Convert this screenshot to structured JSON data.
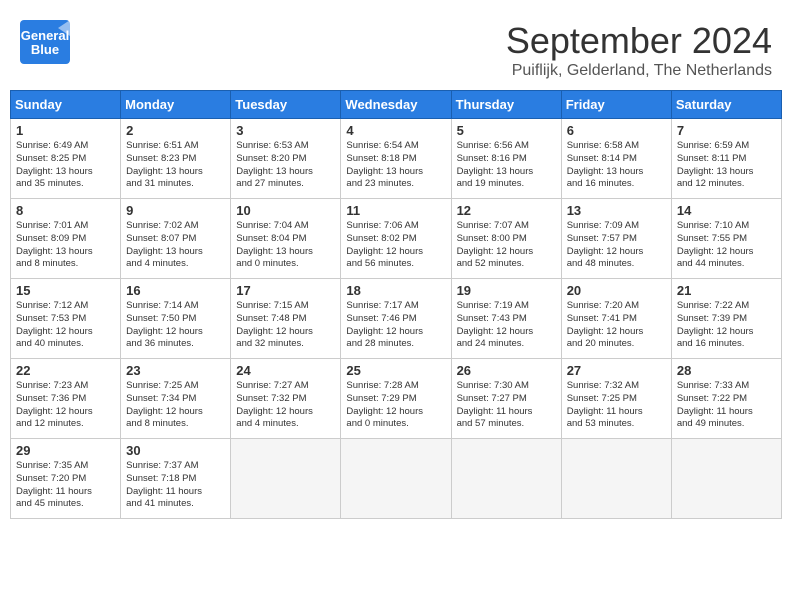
{
  "header": {
    "logo_line1": "General",
    "logo_line2": "Blue",
    "month": "September 2024",
    "location": "Puiflijk, Gelderland, The Netherlands"
  },
  "weekdays": [
    "Sunday",
    "Monday",
    "Tuesday",
    "Wednesday",
    "Thursday",
    "Friday",
    "Saturday"
  ],
  "weeks": [
    [
      {
        "day": "1",
        "info": "Sunrise: 6:49 AM\nSunset: 8:25 PM\nDaylight: 13 hours\nand 35 minutes."
      },
      {
        "day": "2",
        "info": "Sunrise: 6:51 AM\nSunset: 8:23 PM\nDaylight: 13 hours\nand 31 minutes."
      },
      {
        "day": "3",
        "info": "Sunrise: 6:53 AM\nSunset: 8:20 PM\nDaylight: 13 hours\nand 27 minutes."
      },
      {
        "day": "4",
        "info": "Sunrise: 6:54 AM\nSunset: 8:18 PM\nDaylight: 13 hours\nand 23 minutes."
      },
      {
        "day": "5",
        "info": "Sunrise: 6:56 AM\nSunset: 8:16 PM\nDaylight: 13 hours\nand 19 minutes."
      },
      {
        "day": "6",
        "info": "Sunrise: 6:58 AM\nSunset: 8:14 PM\nDaylight: 13 hours\nand 16 minutes."
      },
      {
        "day": "7",
        "info": "Sunrise: 6:59 AM\nSunset: 8:11 PM\nDaylight: 13 hours\nand 12 minutes."
      }
    ],
    [
      {
        "day": "8",
        "info": "Sunrise: 7:01 AM\nSunset: 8:09 PM\nDaylight: 13 hours\nand 8 minutes."
      },
      {
        "day": "9",
        "info": "Sunrise: 7:02 AM\nSunset: 8:07 PM\nDaylight: 13 hours\nand 4 minutes."
      },
      {
        "day": "10",
        "info": "Sunrise: 7:04 AM\nSunset: 8:04 PM\nDaylight: 13 hours\nand 0 minutes."
      },
      {
        "day": "11",
        "info": "Sunrise: 7:06 AM\nSunset: 8:02 PM\nDaylight: 12 hours\nand 56 minutes."
      },
      {
        "day": "12",
        "info": "Sunrise: 7:07 AM\nSunset: 8:00 PM\nDaylight: 12 hours\nand 52 minutes."
      },
      {
        "day": "13",
        "info": "Sunrise: 7:09 AM\nSunset: 7:57 PM\nDaylight: 12 hours\nand 48 minutes."
      },
      {
        "day": "14",
        "info": "Sunrise: 7:10 AM\nSunset: 7:55 PM\nDaylight: 12 hours\nand 44 minutes."
      }
    ],
    [
      {
        "day": "15",
        "info": "Sunrise: 7:12 AM\nSunset: 7:53 PM\nDaylight: 12 hours\nand 40 minutes."
      },
      {
        "day": "16",
        "info": "Sunrise: 7:14 AM\nSunset: 7:50 PM\nDaylight: 12 hours\nand 36 minutes."
      },
      {
        "day": "17",
        "info": "Sunrise: 7:15 AM\nSunset: 7:48 PM\nDaylight: 12 hours\nand 32 minutes."
      },
      {
        "day": "18",
        "info": "Sunrise: 7:17 AM\nSunset: 7:46 PM\nDaylight: 12 hours\nand 28 minutes."
      },
      {
        "day": "19",
        "info": "Sunrise: 7:19 AM\nSunset: 7:43 PM\nDaylight: 12 hours\nand 24 minutes."
      },
      {
        "day": "20",
        "info": "Sunrise: 7:20 AM\nSunset: 7:41 PM\nDaylight: 12 hours\nand 20 minutes."
      },
      {
        "day": "21",
        "info": "Sunrise: 7:22 AM\nSunset: 7:39 PM\nDaylight: 12 hours\nand 16 minutes."
      }
    ],
    [
      {
        "day": "22",
        "info": "Sunrise: 7:23 AM\nSunset: 7:36 PM\nDaylight: 12 hours\nand 12 minutes."
      },
      {
        "day": "23",
        "info": "Sunrise: 7:25 AM\nSunset: 7:34 PM\nDaylight: 12 hours\nand 8 minutes."
      },
      {
        "day": "24",
        "info": "Sunrise: 7:27 AM\nSunset: 7:32 PM\nDaylight: 12 hours\nand 4 minutes."
      },
      {
        "day": "25",
        "info": "Sunrise: 7:28 AM\nSunset: 7:29 PM\nDaylight: 12 hours\nand 0 minutes."
      },
      {
        "day": "26",
        "info": "Sunrise: 7:30 AM\nSunset: 7:27 PM\nDaylight: 11 hours\nand 57 minutes."
      },
      {
        "day": "27",
        "info": "Sunrise: 7:32 AM\nSunset: 7:25 PM\nDaylight: 11 hours\nand 53 minutes."
      },
      {
        "day": "28",
        "info": "Sunrise: 7:33 AM\nSunset: 7:22 PM\nDaylight: 11 hours\nand 49 minutes."
      }
    ],
    [
      {
        "day": "29",
        "info": "Sunrise: 7:35 AM\nSunset: 7:20 PM\nDaylight: 11 hours\nand 45 minutes."
      },
      {
        "day": "30",
        "info": "Sunrise: 7:37 AM\nSunset: 7:18 PM\nDaylight: 11 hours\nand 41 minutes."
      },
      {
        "day": "",
        "info": ""
      },
      {
        "day": "",
        "info": ""
      },
      {
        "day": "",
        "info": ""
      },
      {
        "day": "",
        "info": ""
      },
      {
        "day": "",
        "info": ""
      }
    ]
  ]
}
